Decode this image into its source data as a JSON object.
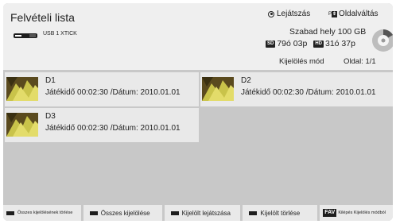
{
  "header": {
    "title": "Felvételi lista",
    "usb_label": "USB 1 XTICK",
    "playback_mode": "Lejátszás",
    "page_key_prefix": "P",
    "page_switch": "Oldalváltás",
    "free_space": "Szabad hely 100 GB",
    "sd_badge": "SD",
    "sd_value": "79ó 03p",
    "hd_badge": "HD",
    "hd_value": "31ó 37p",
    "select_mode": "Kijelölés mód",
    "page_info": "Oldal: 1/1"
  },
  "recordings": [
    {
      "name": "D1",
      "meta": "Játékidő 00:02:30 /Dátum: 2010.01.01"
    },
    {
      "name": "D2",
      "meta": "Játékidő 00:02:30 /Dátum: 2010.01.01"
    },
    {
      "name": "D3",
      "meta": "Játékidő 00:02:30 /Dátum: 2010.01.01"
    }
  ],
  "footer": {
    "deselect_all": "Összes kijelölésének törlése",
    "select_all": "Összes kijelölése",
    "play_selected": "Kijelölt lejátszása",
    "delete_selected": "Kijelölt törlése",
    "fav_key": "FAV",
    "exit_select_mode": "Kilépés Kijelölés módból"
  },
  "colors": {
    "background": "#c8c8c8",
    "header": "#efefef",
    "item": "#e9e9e9",
    "key": "#1e1e1e"
  },
  "icons": [
    "usb-icon",
    "radio-selected-icon",
    "page-key-icon",
    "disk-usage-icon",
    "red-key-icon",
    "green-key-icon",
    "yellow-key-icon",
    "blue-key-icon",
    "fav-key-icon"
  ]
}
